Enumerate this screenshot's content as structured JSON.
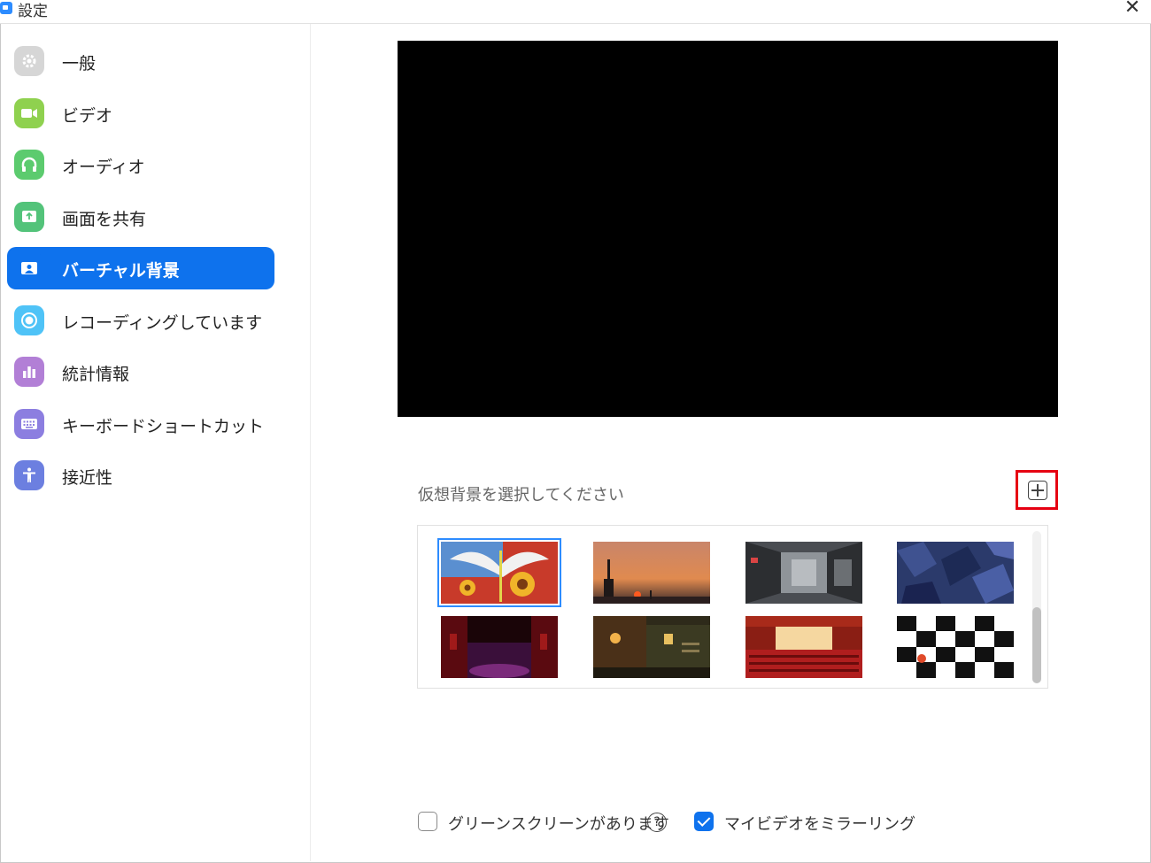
{
  "window": {
    "title": "設定",
    "close_glyph": "✕"
  },
  "sidebar": {
    "items": [
      {
        "label": "一般",
        "icon": "gear-icon",
        "color": "#d3d3d3"
      },
      {
        "label": "ビデオ",
        "icon": "video-camera-icon",
        "color": "#8fd14f"
      },
      {
        "label": "オーディオ",
        "icon": "headphones-icon",
        "color": "#5ccb6e"
      },
      {
        "label": "画面を共有",
        "icon": "share-screen-icon",
        "color": "#53c37a"
      },
      {
        "label": "バーチャル背景",
        "icon": "virtual-background-icon",
        "color": "#0e72ed",
        "active": true
      },
      {
        "label": "レコーディングしています",
        "icon": "record-icon",
        "color": "#4fc3f7"
      },
      {
        "label": "統計情報",
        "icon": "statistics-icon",
        "color": "#b27fd6"
      },
      {
        "label": "キーボードショートカット",
        "icon": "keyboard-icon",
        "color": "#8c7ee0"
      },
      {
        "label": "接近性",
        "icon": "accessibility-icon",
        "color": "#6c7fe0"
      }
    ]
  },
  "main": {
    "choose_label": "仮想背景を選択してください",
    "add_icon": "plus-icon",
    "thumbnails": [
      {
        "name": "dove-sunflower-painting",
        "selected": true
      },
      {
        "name": "sunset-tower"
      },
      {
        "name": "spaceship-interior"
      },
      {
        "name": "blue-crystal-room"
      },
      {
        "name": "red-curtain-stage"
      },
      {
        "name": "night-town"
      },
      {
        "name": "theater-hall"
      },
      {
        "name": "logo-backdrop"
      }
    ],
    "options": {
      "green_screen": {
        "label": "グリーンスクリーンがあります",
        "checked": false
      },
      "help_glyph": "?",
      "mirror": {
        "label": "マイビデオをミラーリング",
        "checked": true
      }
    }
  }
}
